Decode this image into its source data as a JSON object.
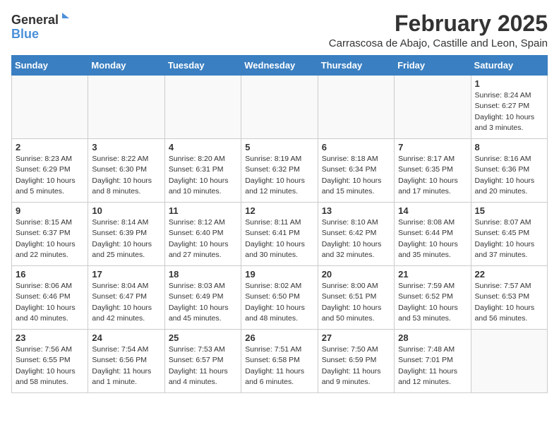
{
  "logo": {
    "line1": "General",
    "line2": "Blue"
  },
  "title": "February 2025",
  "location": "Carrascosa de Abajo, Castille and Leon, Spain",
  "weekdays": [
    "Sunday",
    "Monday",
    "Tuesday",
    "Wednesday",
    "Thursday",
    "Friday",
    "Saturday"
  ],
  "weeks": [
    [
      {
        "day": "",
        "info": ""
      },
      {
        "day": "",
        "info": ""
      },
      {
        "day": "",
        "info": ""
      },
      {
        "day": "",
        "info": ""
      },
      {
        "day": "",
        "info": ""
      },
      {
        "day": "",
        "info": ""
      },
      {
        "day": "1",
        "info": "Sunrise: 8:24 AM\nSunset: 6:27 PM\nDaylight: 10 hours\nand 3 minutes."
      }
    ],
    [
      {
        "day": "2",
        "info": "Sunrise: 8:23 AM\nSunset: 6:29 PM\nDaylight: 10 hours\nand 5 minutes."
      },
      {
        "day": "3",
        "info": "Sunrise: 8:22 AM\nSunset: 6:30 PM\nDaylight: 10 hours\nand 8 minutes."
      },
      {
        "day": "4",
        "info": "Sunrise: 8:20 AM\nSunset: 6:31 PM\nDaylight: 10 hours\nand 10 minutes."
      },
      {
        "day": "5",
        "info": "Sunrise: 8:19 AM\nSunset: 6:32 PM\nDaylight: 10 hours\nand 12 minutes."
      },
      {
        "day": "6",
        "info": "Sunrise: 8:18 AM\nSunset: 6:34 PM\nDaylight: 10 hours\nand 15 minutes."
      },
      {
        "day": "7",
        "info": "Sunrise: 8:17 AM\nSunset: 6:35 PM\nDaylight: 10 hours\nand 17 minutes."
      },
      {
        "day": "8",
        "info": "Sunrise: 8:16 AM\nSunset: 6:36 PM\nDaylight: 10 hours\nand 20 minutes."
      }
    ],
    [
      {
        "day": "9",
        "info": "Sunrise: 8:15 AM\nSunset: 6:37 PM\nDaylight: 10 hours\nand 22 minutes."
      },
      {
        "day": "10",
        "info": "Sunrise: 8:14 AM\nSunset: 6:39 PM\nDaylight: 10 hours\nand 25 minutes."
      },
      {
        "day": "11",
        "info": "Sunrise: 8:12 AM\nSunset: 6:40 PM\nDaylight: 10 hours\nand 27 minutes."
      },
      {
        "day": "12",
        "info": "Sunrise: 8:11 AM\nSunset: 6:41 PM\nDaylight: 10 hours\nand 30 minutes."
      },
      {
        "day": "13",
        "info": "Sunrise: 8:10 AM\nSunset: 6:42 PM\nDaylight: 10 hours\nand 32 minutes."
      },
      {
        "day": "14",
        "info": "Sunrise: 8:08 AM\nSunset: 6:44 PM\nDaylight: 10 hours\nand 35 minutes."
      },
      {
        "day": "15",
        "info": "Sunrise: 8:07 AM\nSunset: 6:45 PM\nDaylight: 10 hours\nand 37 minutes."
      }
    ],
    [
      {
        "day": "16",
        "info": "Sunrise: 8:06 AM\nSunset: 6:46 PM\nDaylight: 10 hours\nand 40 minutes."
      },
      {
        "day": "17",
        "info": "Sunrise: 8:04 AM\nSunset: 6:47 PM\nDaylight: 10 hours\nand 42 minutes."
      },
      {
        "day": "18",
        "info": "Sunrise: 8:03 AM\nSunset: 6:49 PM\nDaylight: 10 hours\nand 45 minutes."
      },
      {
        "day": "19",
        "info": "Sunrise: 8:02 AM\nSunset: 6:50 PM\nDaylight: 10 hours\nand 48 minutes."
      },
      {
        "day": "20",
        "info": "Sunrise: 8:00 AM\nSunset: 6:51 PM\nDaylight: 10 hours\nand 50 minutes."
      },
      {
        "day": "21",
        "info": "Sunrise: 7:59 AM\nSunset: 6:52 PM\nDaylight: 10 hours\nand 53 minutes."
      },
      {
        "day": "22",
        "info": "Sunrise: 7:57 AM\nSunset: 6:53 PM\nDaylight: 10 hours\nand 56 minutes."
      }
    ],
    [
      {
        "day": "23",
        "info": "Sunrise: 7:56 AM\nSunset: 6:55 PM\nDaylight: 10 hours\nand 58 minutes."
      },
      {
        "day": "24",
        "info": "Sunrise: 7:54 AM\nSunset: 6:56 PM\nDaylight: 11 hours\nand 1 minute."
      },
      {
        "day": "25",
        "info": "Sunrise: 7:53 AM\nSunset: 6:57 PM\nDaylight: 11 hours\nand 4 minutes."
      },
      {
        "day": "26",
        "info": "Sunrise: 7:51 AM\nSunset: 6:58 PM\nDaylight: 11 hours\nand 6 minutes."
      },
      {
        "day": "27",
        "info": "Sunrise: 7:50 AM\nSunset: 6:59 PM\nDaylight: 11 hours\nand 9 minutes."
      },
      {
        "day": "28",
        "info": "Sunrise: 7:48 AM\nSunset: 7:01 PM\nDaylight: 11 hours\nand 12 minutes."
      },
      {
        "day": "",
        "info": ""
      }
    ]
  ]
}
